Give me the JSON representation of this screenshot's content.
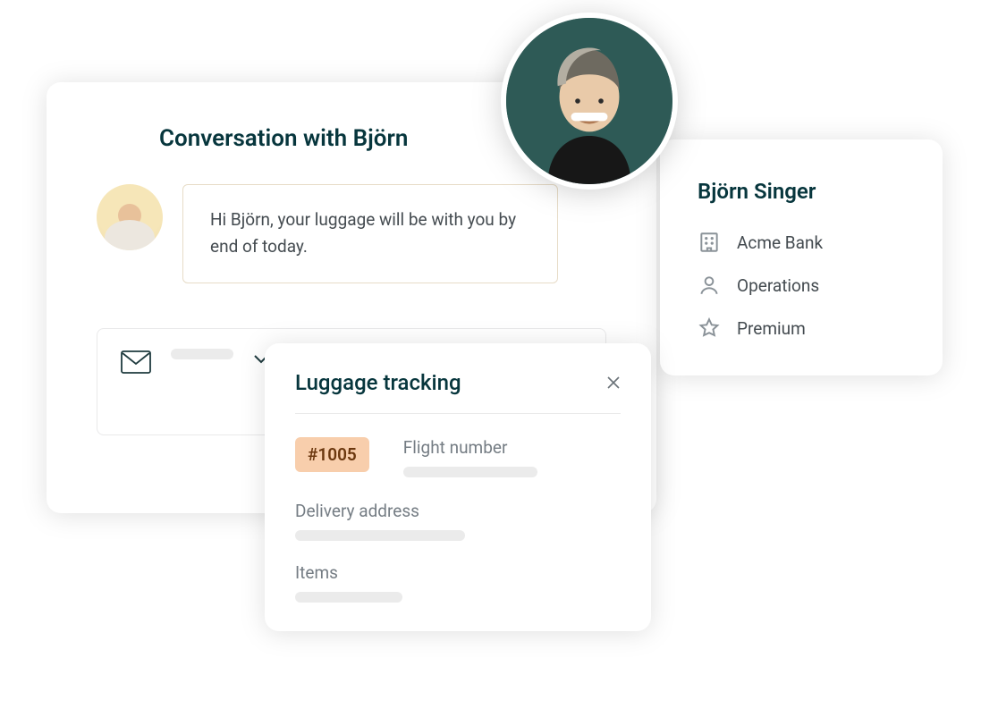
{
  "conversation": {
    "title": "Conversation with Björn",
    "message": "Hi Björn, your luggage will be with you by end of today."
  },
  "profile": {
    "name": "Björn Singer",
    "items": [
      {
        "icon": "building-icon",
        "label": "Acme Bank"
      },
      {
        "icon": "person-icon",
        "label": "Operations"
      },
      {
        "icon": "star-icon",
        "label": "Premium"
      }
    ]
  },
  "tracking": {
    "title": "Luggage tracking",
    "ticket_id": "#1005",
    "fields": {
      "flight_number": "Flight number",
      "delivery_address": "Delivery address",
      "items": "Items"
    }
  }
}
